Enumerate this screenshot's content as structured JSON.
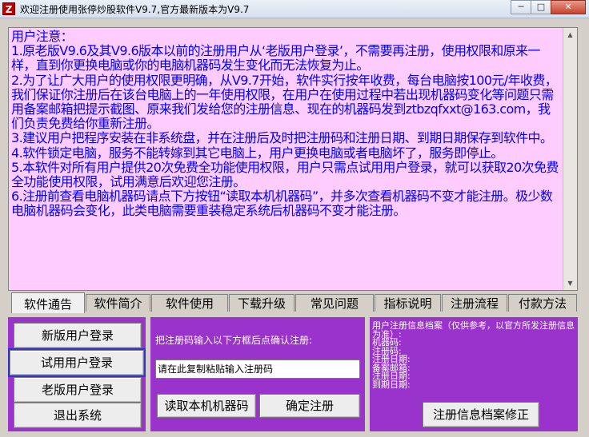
{
  "window": {
    "title": "欢迎注册使用张停炒股软件V9.7,官方最新版本为V9.7",
    "icon_glyph": "Z",
    "minimize_glyph": "─",
    "maximize_glyph": "□",
    "close_glyph": "✕"
  },
  "notice": {
    "text": "用户注意：\n1.原老版V9.6及其V9.6版本以前的注册用户从‘老版用户登录’，不需要再注册，使用权限和原来一样，直到你更换电脑或你的电脑机器码发生变化而无法恢复为止。\n2.为了让广大用户的使用权限更明确，从V9.7开始，软件实行按年收费，每台电脑按100元/年收费，我们保证你注册后在该台电脑上的一年使用权限，在用户在使用过程中若出现机器码变化等问题只需用备案邮箱把提示截图、原来我们发给您的注册信息、现在的机器码发到ztbzqfxxt@163.com，我们负责免费给你重新注册。\n3.建议用户把程序安装在非系统盘，并在注册后及时把注册码和注册日期、到期日期保存到软件中。\n4.软件锁定电脑，服务不能转嫁到其它电脑上，用户更换电脑或者电脑坏了，服务即停止。\n5.本软件对所有用户提供20次免费全功能使用权限，用户只需点试用用户登录，就可以获取20次免费全功能使用权限，试用满意后欢迎您注册。\n6.注册前查看电脑机器码请点下方按钮“读取本机机器码”，并多次查看机器码不变才能注册。极少数电脑机器码会变化，此类电脑需要重装稳定系统后机器码不变才能注册。"
  },
  "tabs": [
    "软件通告",
    "软件简介",
    "软件使用",
    "下载升级",
    "常见问题",
    "指标说明",
    "注册流程",
    "付款方法"
  ],
  "login": {
    "new_user": "新版用户登录",
    "trial_user": "试用用户登录",
    "old_user": "老版用户登录",
    "exit": "退出系统"
  },
  "register": {
    "instruction": "把注册码输入以下方框后点确认注册:",
    "input_value": "请在此复制粘贴输入注册码",
    "read_machine_code": "读取本机机器码",
    "confirm": "确定注册"
  },
  "archive": {
    "header": "用户注册信息档案（仅供参考，以官方所发注册信息为准）:",
    "fields": [
      "机器码:",
      "注册码:",
      "注册日期:",
      "备案邮箱:",
      "注册日期:",
      "到期日期:"
    ],
    "edit_button": "注册信息档案修正"
  },
  "colors": {
    "notice_bg": "#ffccff",
    "notice_text": "#0000ff",
    "panel_bg": "#9933cc"
  }
}
